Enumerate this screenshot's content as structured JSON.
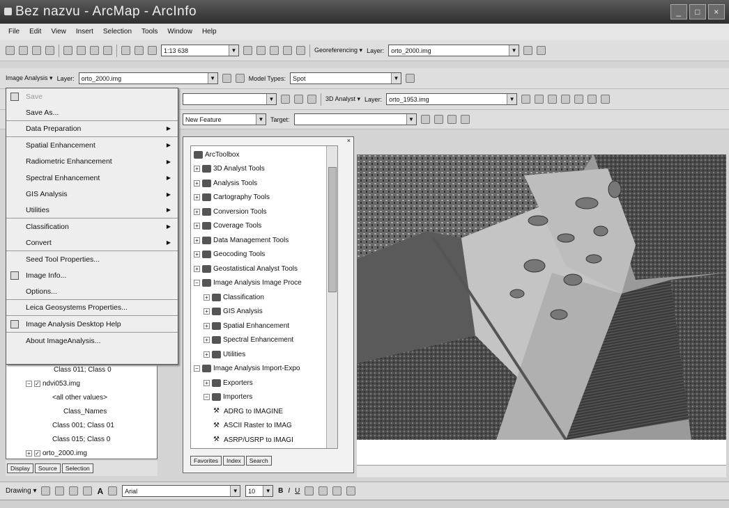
{
  "window": {
    "title": "Bez nazvu - ArcMap - ArcInfo",
    "controls": [
      "_",
      "□",
      "×"
    ]
  },
  "menubar": [
    "File",
    "Edit",
    "View",
    "Insert",
    "Selection",
    "Tools",
    "Window",
    "Help"
  ],
  "standard_toolbar": {
    "scale": "1:13 638",
    "georef_label": "Georeferencing ▾",
    "layer_label": "Layer:",
    "layer_value": "orto_2000.img"
  },
  "image_analysis_toolbar": {
    "menu_label": "Image Analysis ▾",
    "layer_label": "Layer:",
    "layer_value": "orto_2000.img",
    "model_types_label": "Model Types:",
    "model_types_value": "Spot"
  },
  "analyst_toolbar": {
    "menu_label": "3D Analyst ▾",
    "layer_label": "Layer:",
    "layer_value": "orto_1953.img"
  },
  "editor_toolbar": {
    "task_value": "New Feature",
    "target_label": "Target:"
  },
  "image_analysis_menu": [
    {
      "label": "Save",
      "disabled": true,
      "icon": "disk-icon"
    },
    {
      "label": "Save As...",
      "sep": true
    },
    {
      "label": "Data Preparation",
      "sub": true,
      "sep": true
    },
    {
      "label": "Spatial Enhancement",
      "sub": true
    },
    {
      "label": "Radiometric Enhancement",
      "sub": true
    },
    {
      "label": "Spectral Enhancement",
      "sub": true
    },
    {
      "label": "GIS Analysis",
      "sub": true
    },
    {
      "label": "Utilities",
      "sub": true,
      "sep": true
    },
    {
      "label": "Classification",
      "sub": true
    },
    {
      "label": "Convert",
      "sub": true,
      "sep": true
    },
    {
      "label": "Seed Tool Properties..."
    },
    {
      "label": "Image Info...",
      "icon": "info-icon"
    },
    {
      "label": "Options...",
      "sep": true
    },
    {
      "label": "Leica Geosystems Properties...",
      "sep": true
    },
    {
      "label": "Image Analysis Desktop Help",
      "icon": "help-icon",
      "sep": true
    },
    {
      "label": "About ImageAnalysis..."
    }
  ],
  "toc": {
    "rows": [
      {
        "text": "Class 011; Class 0",
        "indent": 68
      },
      {
        "text": "ndvi053.img",
        "indent": 28,
        "expander": "−",
        "checkbox": true
      },
      {
        "text": "<all other values>",
        "indent": 66
      },
      {
        "text": "Class_Names",
        "indent": 82
      },
      {
        "text": "Class 001; Class 01",
        "indent": 66
      },
      {
        "text": "Class 015; Class 0",
        "indent": 66
      },
      {
        "text": "orto_2000.img",
        "indent": 28,
        "expander": "+",
        "checkbox": true
      }
    ],
    "tabs": [
      "Display",
      "Source",
      "Selection"
    ]
  },
  "arctoolbox": {
    "rows": [
      {
        "text": "ArcToolbox",
        "level": 0,
        "kind": "root"
      },
      {
        "text": "3D Analyst Tools",
        "level": 0,
        "kind": "box",
        "pm": "+"
      },
      {
        "text": "Analysis Tools",
        "level": 0,
        "kind": "box",
        "pm": "+"
      },
      {
        "text": "Cartography Tools",
        "level": 0,
        "kind": "box",
        "pm": "+"
      },
      {
        "text": "Conversion Tools",
        "level": 0,
        "kind": "box",
        "pm": "+"
      },
      {
        "text": "Coverage Tools",
        "level": 0,
        "kind": "box",
        "pm": "+"
      },
      {
        "text": "Data Management Tools",
        "level": 0,
        "kind": "box",
        "pm": "+"
      },
      {
        "text": "Geocoding Tools",
        "level": 0,
        "kind": "box",
        "pm": "+"
      },
      {
        "text": "Geostatistical Analyst Tools",
        "level": 0,
        "kind": "box",
        "pm": "+"
      },
      {
        "text": "Image Analysis Image Proce",
        "level": 0,
        "kind": "box",
        "pm": "−"
      },
      {
        "text": "Classification",
        "level": 1,
        "kind": "box",
        "pm": "+"
      },
      {
        "text": "GIS Analysis",
        "level": 1,
        "kind": "box",
        "pm": "+"
      },
      {
        "text": "Spatial Enhancement",
        "level": 1,
        "kind": "box",
        "pm": "+"
      },
      {
        "text": "Spectral Enhancement",
        "level": 1,
        "kind": "box",
        "pm": "+"
      },
      {
        "text": "Utilities",
        "level": 1,
        "kind": "box",
        "pm": "+"
      },
      {
        "text": "Image Analysis Import-Expo",
        "level": 0,
        "kind": "box",
        "pm": "−"
      },
      {
        "text": "Exporters",
        "level": 1,
        "kind": "box",
        "pm": "+"
      },
      {
        "text": "Importers",
        "level": 1,
        "kind": "box",
        "pm": "−"
      },
      {
        "text": "ADRG to IMAGINE",
        "level": 2,
        "kind": "tool"
      },
      {
        "text": "ASCII Raster to IMAG",
        "level": 2,
        "kind": "tool"
      },
      {
        "text": "ASRP/USRP to IMAGI",
        "level": 2,
        "kind": "tool"
      },
      {
        "text": "AVHRR Dundee to IM.",
        "level": 2,
        "kind": "tool"
      },
      {
        "text": "AVHRR ESA SHARP to",
        "level": 2,
        "kind": "tool"
      },
      {
        "text": "AVHRR NOAA and NC",
        "level": 2,
        "kind": "tool"
      }
    ],
    "tabs": [
      "Favorites",
      "Index",
      "Search"
    ]
  },
  "drawing_toolbar": {
    "drawing_label": "Drawing ▾",
    "font": "Arial",
    "size": "10",
    "bold": "B",
    "italic": "I",
    "underline": "U"
  }
}
